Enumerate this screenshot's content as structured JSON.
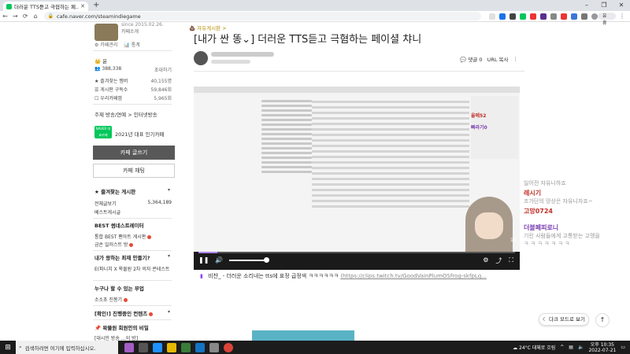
{
  "browser": {
    "tab_title": "더러운 TTS듣고 극협하는 페...",
    "tab_close": "✕",
    "new_tab": "+",
    "url": "cafe.naver.com/steamindiegame",
    "sync_label": "유휴",
    "controls": [
      "–",
      "❐",
      "✕"
    ],
    "nav": [
      "←",
      "→",
      "⟳",
      "⌂"
    ]
  },
  "sidebar": {
    "since": "since 2015.02.26.",
    "invite": "카페소개",
    "mgmt": [
      "카페관리",
      "통계"
    ],
    "grade_label": "윤",
    "member_count": "388,338",
    "invite_label": "초대하기",
    "stats": [
      {
        "label": "즐겨찾는 멤버",
        "value": "40,155명"
      },
      {
        "label": "게시판 구독수",
        "value": "59,846회"
      },
      {
        "label": "우리카페앱",
        "value": "5,965회"
      }
    ],
    "topic": "주제  방송/연예 > 인터넷방송",
    "badge_text": "NAVER 대표카페",
    "popular": "2021년 대표 인기카페",
    "write_btn": "카페 글쓰기",
    "chat_btn": "카페 채팅",
    "favorites_title": "즐겨찾는 게시판",
    "favorites": [
      {
        "label": "전체글보기",
        "value": "5,364,189"
      },
      {
        "label": "베스트게시글",
        "value": ""
      }
    ],
    "best_title": "BEST 썸네스트레이터",
    "best_items": [
      "통합 BEST 팬아트 게시판",
      "금손 일러스트 방"
    ],
    "section2": "내가 왕하는 최재 만들기?",
    "section2_item": "E(파니치 X 왁물원 2차 의자 콘테스트",
    "section3": "누구나 할 수 있는 부업",
    "section3_item": "소소초 진봉기",
    "section4": "[확인!] 진행중인 컨텐츠",
    "section5": "왁물원 회원만의 비밀",
    "section5_item": "[대시민 방송 …이 방]"
  },
  "post": {
    "board": "자유게시판 >",
    "title": "[내가 싼 똥⌄] 더러운 TTS듣고 극혐하는 페이셜 챠니",
    "comments": "댓글 0",
    "url_copy": "URL 복사",
    "more": "⋮",
    "caption_channel": "비챤_",
    "caption_text": " - 더러운 소리내는 tts에 표정 급정색 ㅋㅋㅋㅋㅋㅋ",
    "caption_link": "(https://clips.twitch.tv/GoodVainPlumOSfrog-skfpLq..."
  },
  "video": {
    "side_nick1": "울매52",
    "side_nick2": "빠라기0",
    "timestamp": "15",
    "play_icon": "❚❚",
    "volume_icon": "🔊",
    "right_icons": [
      "⚙",
      "⤴",
      "⛶"
    ],
    "progress_pct": 6
  },
  "chat": [
    {
      "name": "",
      "msg": "일어전 자유니하죠",
      "color": "#999"
    },
    {
      "name": "레시기",
      "msg": "조가단의 망상은 자유니자죠~",
      "color": "#c0322a"
    },
    {
      "name": "고망0724",
      "msg": "",
      "color": "#c0322a"
    },
    {
      "name": "더블페피로니",
      "msg": "기린 사람들에게 고통받는 고멩을 ",
      "color": "#7a3fb0"
    },
    {
      "name": "",
      "msg": "ㅋ ㅋ ㅋ ㅋ ㅋ ㅋ ㅋ",
      "color": "#999"
    }
  ],
  "floating": {
    "dark_mode": "다크 모드로 보기",
    "top": "↑"
  },
  "taskbar": {
    "search_placeholder": "검색하려면 여기에 입력하십시오.",
    "weather": "24°C 대체로 흐림",
    "time": "오후 10:35",
    "date": "2022-07-21"
  }
}
